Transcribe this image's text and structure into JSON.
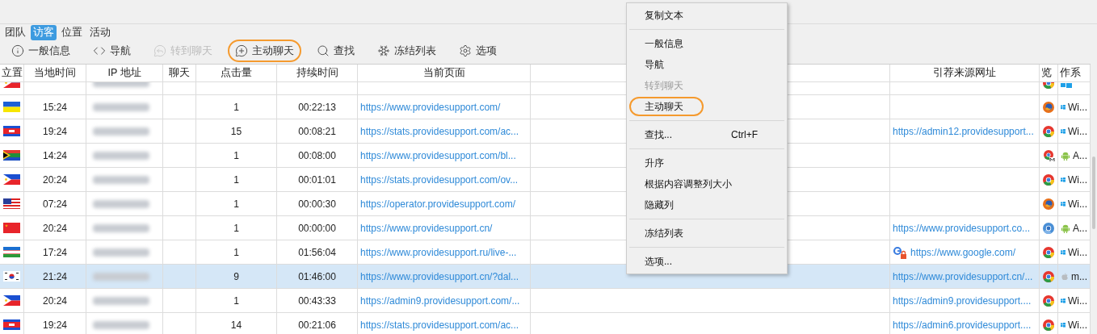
{
  "tabs": [
    {
      "label": "团队",
      "selected": false
    },
    {
      "label": "访客",
      "selected": true
    },
    {
      "label": "位置",
      "selected": false
    },
    {
      "label": "活动",
      "selected": false
    }
  ],
  "toolbar": [
    {
      "kind": "info",
      "label": "一般信息",
      "disabled": false,
      "circled": false
    },
    {
      "kind": "code",
      "label": "导航",
      "disabled": false,
      "circled": false
    },
    {
      "kind": "chat-forward",
      "label": "转到聊天",
      "disabled": true,
      "circled": false
    },
    {
      "kind": "chat-plus",
      "label": "主动聊天",
      "disabled": false,
      "circled": true
    },
    {
      "kind": "search",
      "label": "查找",
      "disabled": false,
      "circled": false
    },
    {
      "kind": "snowflake",
      "label": "冻结列表",
      "disabled": false,
      "circled": false
    },
    {
      "kind": "gear",
      "label": "选项",
      "disabled": false,
      "circled": false
    }
  ],
  "table": {
    "columns": [
      "立置",
      "当地时间",
      "IP 地址",
      "聊天",
      "点击量",
      "持续时间",
      "当前页面",
      "引荐来源网址",
      "览",
      "作系"
    ],
    "rows": [
      {
        "flag": {
          "kind": "ph"
        },
        "browser": {
          "kind": "chrome"
        },
        "os": {
          "kind": "windows"
        },
        "selected": false
      },
      {
        "flag": {
          "kind": "ua"
        },
        "time": "15:24",
        "clicks": "1",
        "duration": "00:22:13",
        "page": "https://www.providesupport.com/",
        "browser": {
          "kind": "firefox"
        },
        "os": {
          "kind": "windows",
          "label": "Wi..."
        },
        "selected": false
      },
      {
        "flag": {
          "kind": "kh"
        },
        "time": "19:24",
        "clicks": "15",
        "duration": "00:08:21",
        "page": "https://stats.providesupport.com/ac...",
        "referrer": {
          "text": "https://admin12.providesupport..."
        },
        "browser": {
          "kind": "chrome"
        },
        "os": {
          "kind": "windows",
          "label": "Wi..."
        },
        "selected": false
      },
      {
        "flag": {
          "kind": "za"
        },
        "time": "14:24",
        "clicks": "1",
        "duration": "00:08:00",
        "page": "https://www.providesupport.com/bl...",
        "browser": {
          "kind": "chrome-mobile"
        },
        "os": {
          "kind": "android",
          "label": "A..."
        },
        "selected": false
      },
      {
        "flag": {
          "kind": "ph"
        },
        "time": "20:24",
        "clicks": "1",
        "duration": "00:01:01",
        "page": "https://stats.providesupport.com/ov...",
        "browser": {
          "kind": "chrome"
        },
        "os": {
          "kind": "windows",
          "label": "Wi..."
        },
        "selected": false
      },
      {
        "flag": {
          "kind": "us"
        },
        "time": "07:24",
        "clicks": "1",
        "duration": "00:00:30",
        "page": "https://operator.providesupport.com/",
        "browser": {
          "kind": "firefox"
        },
        "os": {
          "kind": "windows",
          "label": "Wi..."
        },
        "selected": false
      },
      {
        "flag": {
          "kind": "cn"
        },
        "time": "20:24",
        "clicks": "1",
        "duration": "00:00:00",
        "page": "https://www.providesupport.cn/",
        "referrer": {
          "text": "https://www.providesupport.co..."
        },
        "browser": {
          "kind": "chromium"
        },
        "os": {
          "kind": "android",
          "label": "A..."
        },
        "selected": false
      },
      {
        "flag": {
          "kind": "uz"
        },
        "time": "17:24",
        "clicks": "1",
        "duration": "01:56:04",
        "page": "https://www.providesupport.ru/live-...",
        "referrer": {
          "kind": "google",
          "text": "https://www.google.com/"
        },
        "browser": {
          "kind": "chrome"
        },
        "os": {
          "kind": "windows",
          "label": "Wi..."
        },
        "selected": false
      },
      {
        "flag": {
          "kind": "kr"
        },
        "time": "21:24",
        "clicks": "9",
        "duration": "01:46:00",
        "page": "https://www.providesupport.cn/?dal...",
        "referrer": {
          "text": "https://www.providesupport.cn/..."
        },
        "browser": {
          "kind": "chrome"
        },
        "os": {
          "kind": "apple",
          "label": "m..."
        },
        "selected": true
      },
      {
        "flag": {
          "kind": "ph"
        },
        "time": "20:24",
        "clicks": "1",
        "duration": "00:43:33",
        "page": "https://admin9.providesupport.com/...",
        "referrer": {
          "text": "https://admin9.providesupport...."
        },
        "browser": {
          "kind": "chrome"
        },
        "os": {
          "kind": "windows",
          "label": "Wi..."
        },
        "selected": false
      },
      {
        "flag": {
          "kind": "kh"
        },
        "time": "19:24",
        "clicks": "14",
        "duration": "00:21:06",
        "page": "https://stats.providesupport.com/ac...",
        "referrer": {
          "text": "https://admin6.providesupport...."
        },
        "browser": {
          "kind": "chrome"
        },
        "os": {
          "kind": "windows",
          "label": "Wi..."
        },
        "selected": false
      }
    ]
  },
  "context_menu": {
    "groups": [
      [
        {
          "label": "复制文本",
          "disabled": false,
          "circled": false
        }
      ],
      [
        {
          "label": "一般信息",
          "disabled": false,
          "circled": false
        },
        {
          "label": "导航",
          "disabled": false,
          "circled": false
        },
        {
          "label": "转到聊天",
          "disabled": true,
          "circled": false
        },
        {
          "label": "主动聊天",
          "disabled": false,
          "circled": true
        }
      ],
      [
        {
          "label": "查找...",
          "shortcut": "Ctrl+F",
          "disabled": false,
          "circled": false
        }
      ],
      [
        {
          "label": "升序",
          "disabled": false,
          "circled": false
        },
        {
          "label": "根据内容调整列大小",
          "disabled": false,
          "circled": false
        },
        {
          "label": "隐藏列",
          "disabled": false,
          "circled": false
        }
      ],
      [
        {
          "label": "冻结列表",
          "disabled": false,
          "circled": false
        }
      ],
      [
        {
          "label": "选项...",
          "disabled": false,
          "circled": false
        }
      ]
    ]
  }
}
